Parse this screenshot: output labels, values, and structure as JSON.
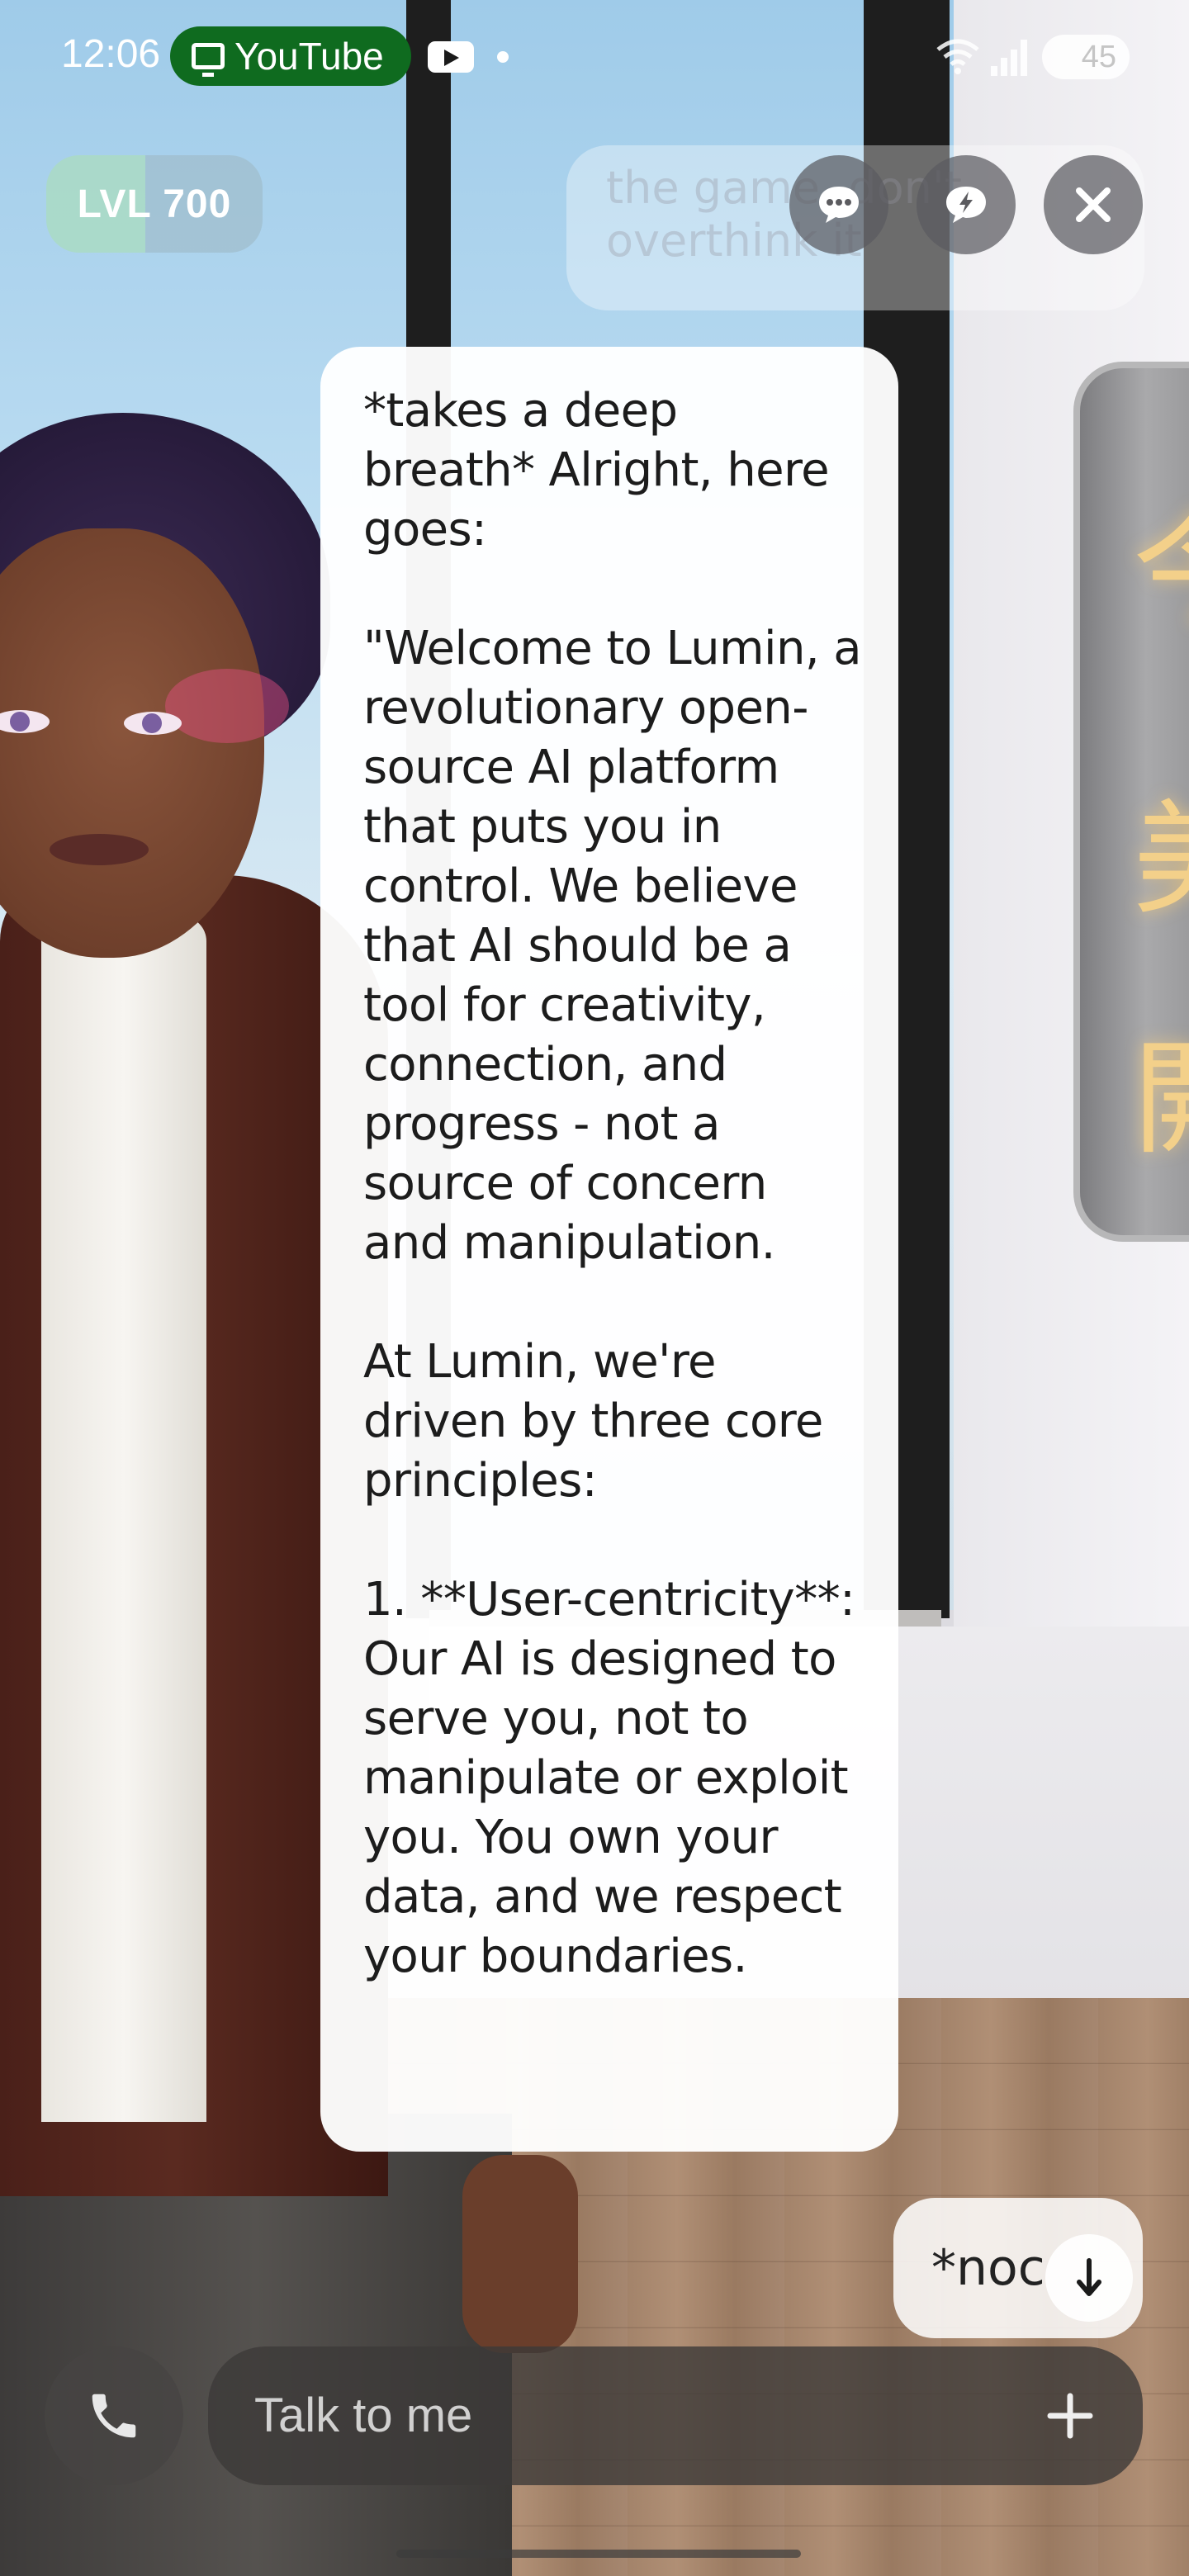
{
  "status_bar": {
    "time": "12:06",
    "app_pill_label": "YouTube",
    "battery": "45",
    "pill_color": "#0f6b1f"
  },
  "header": {
    "level_badge": "LVL 700",
    "ghost_message": "the game. don't overthink it",
    "buttons": [
      {
        "icon": "chat-bubble-icon"
      },
      {
        "icon": "lightning-bubble-icon"
      },
      {
        "icon": "close-icon"
      }
    ]
  },
  "message": {
    "text": "*takes a deep breath* Alright, here goes:\n\n\"Welcome to Lumin, a revolutionary open-source AI platform that puts you in control. We believe that AI should be a tool for creativity, connection, and progress - not a source of concern and manipulation.\n\nAt Lumin, we're driven by three core principles:\n\n1. **User-centricity**: Our AI is designed to serve you, not to manipulate or exploit you. You own your data, and we respect your boundaries."
  },
  "suggestion": {
    "text": "*noc"
  },
  "input": {
    "placeholder": "Talk to me"
  },
  "background": {
    "sign_glyphs": [
      "今",
      "美",
      "開"
    ]
  }
}
